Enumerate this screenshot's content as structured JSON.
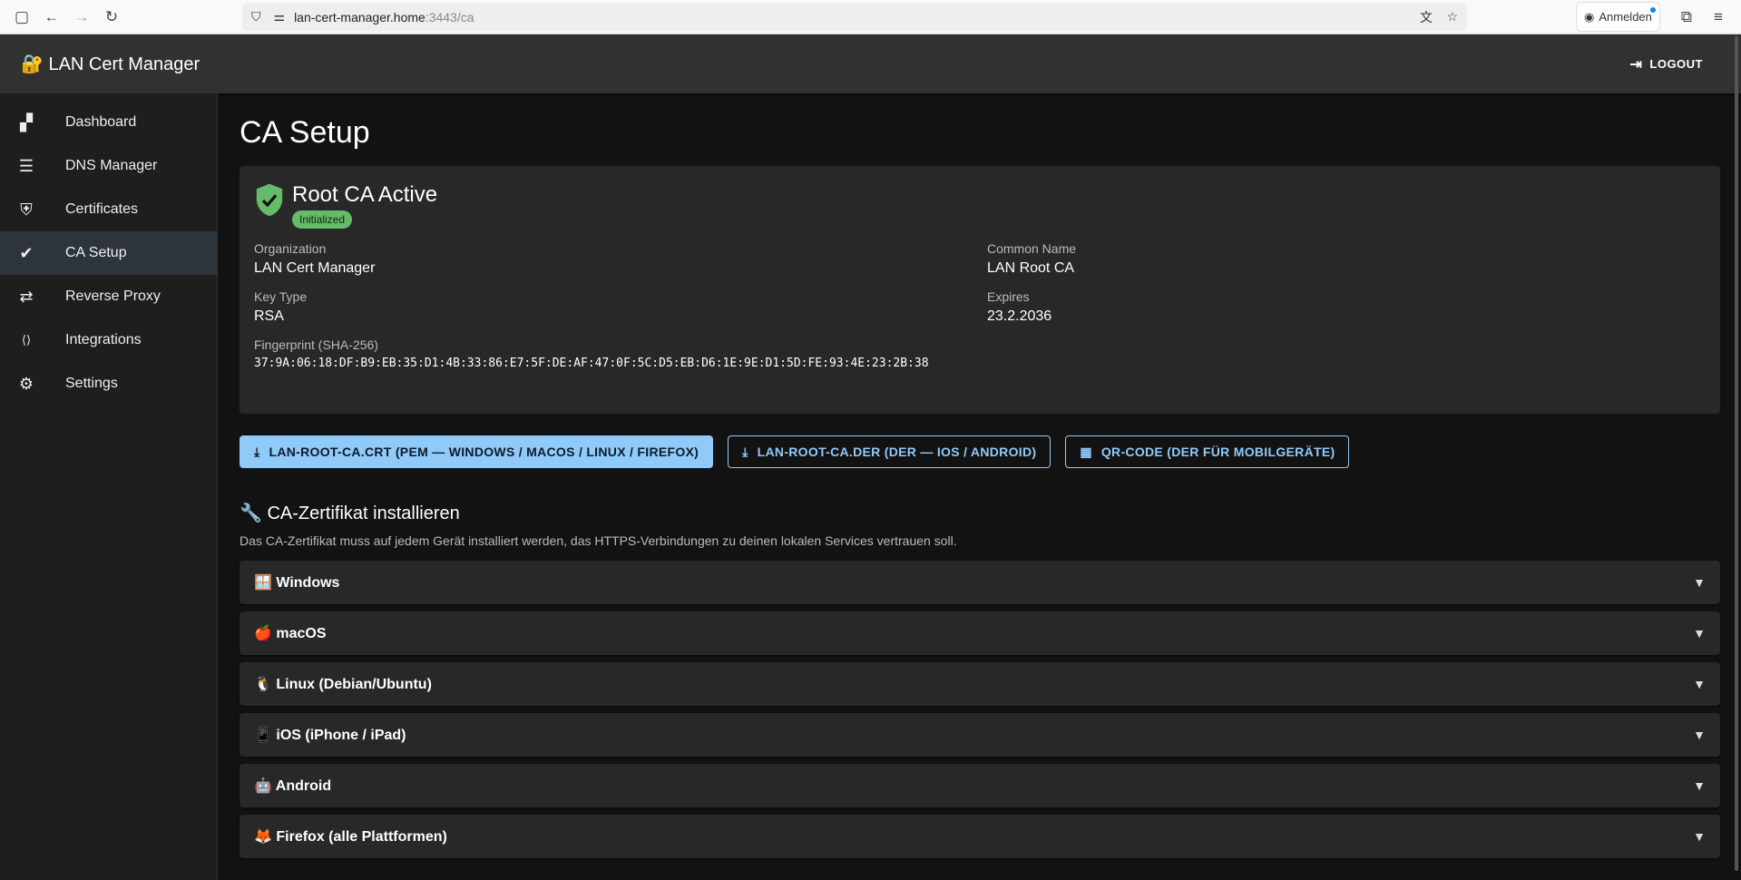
{
  "browser": {
    "url_host": "lan-cert-manager.home",
    "url_path": ":3443/ca",
    "signin": "Anmelden"
  },
  "app": {
    "title": "🔐 LAN Cert Manager",
    "logout": "LOGOUT"
  },
  "sidebar": {
    "items": [
      {
        "label": "Dashboard",
        "icon": "▞"
      },
      {
        "label": "DNS Manager",
        "icon": "☰"
      },
      {
        "label": "Certificates",
        "icon": "⛨"
      },
      {
        "label": "CA Setup",
        "icon": "✔"
      },
      {
        "label": "Reverse Proxy",
        "icon": "⇄"
      },
      {
        "label": "Integrations",
        "icon": "⟨⟩"
      },
      {
        "label": "Settings",
        "icon": "⚙"
      }
    ]
  },
  "page": {
    "title": "CA Setup"
  },
  "ca": {
    "status": "Root CA Active",
    "badge": "Initialized",
    "org_label": "Organization",
    "org": "LAN Cert Manager",
    "cn_label": "Common Name",
    "cn": "LAN Root CA",
    "key_label": "Key Type",
    "key": "RSA",
    "exp_label": "Expires",
    "exp": "23.2.2036",
    "fp_label": "Fingerprint (SHA-256)",
    "fp": "37:9A:06:18:DF:B9:EB:35:D1:4B:33:86:E7:5F:DE:AF:47:0F:5C:D5:EB:D6:1E:9E:D1:5D:FE:93:4E:23:2B:38"
  },
  "buttons": {
    "crt": "LAN-ROOT-CA.CRT (PEM — WINDOWS / MACOS / LINUX / FIREFOX)",
    "der": "LAN-ROOT-CA.DER (DER — IOS / ANDROID)",
    "qr": "QR-CODE (DER FÜR MOBILGERÄTE)"
  },
  "install": {
    "title": "🔧 CA-Zertifikat installieren",
    "desc": "Das CA-Zertifikat muss auf jedem Gerät installiert werden, das HTTPS-Verbindungen zu deinen lokalen Services vertrauen soll.",
    "items": [
      "🪟 Windows",
      "🍎 macOS",
      "🐧 Linux (Debian/Ubuntu)",
      "📱 iOS (iPhone / iPad)",
      "🤖 Android",
      "🦊 Firefox (alle Plattformen)"
    ]
  },
  "colors": {
    "accent": "#90caf9",
    "success": "#66bb6a"
  }
}
